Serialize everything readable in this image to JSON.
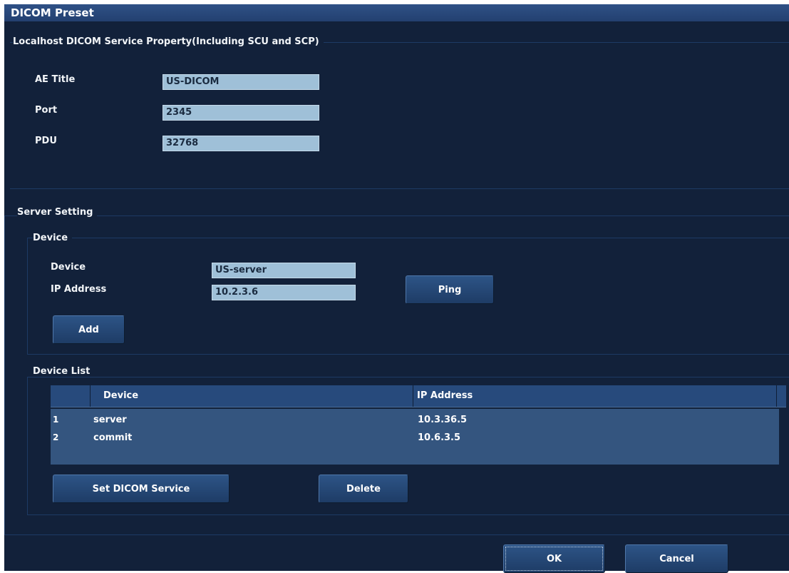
{
  "window": {
    "title": "DICOM Preset"
  },
  "localhost": {
    "group_label": "Localhost DICOM Service Property(Including SCU and SCP)",
    "ae_title_label": "AE Title",
    "ae_title_value": "US-DICOM",
    "port_label": "Port",
    "port_value": "2345",
    "pdu_label": "PDU",
    "pdu_value": "32768"
  },
  "server_setting": {
    "group_label": "Server Setting",
    "device_group": {
      "group_label": "Device",
      "device_label": "Device",
      "device_value": "US-server",
      "ip_label": "IP Address",
      "ip_value": "10.2.3.6",
      "ping_label": "Ping",
      "add_label": "Add"
    },
    "device_list": {
      "group_label": "Device List",
      "columns": [
        "Device",
        "IP Address"
      ],
      "rows": [
        {
          "index": "1",
          "device": "server",
          "ip": "10.3.36.5"
        },
        {
          "index": "2",
          "device": "commit",
          "ip": "10.6.3.5"
        }
      ],
      "set_service_label": "Set DICOM Service",
      "delete_label": "Delete"
    }
  },
  "footer": {
    "ok_label": "OK",
    "cancel_label": "Cancel"
  },
  "colors": {
    "background": "#12213a",
    "titlebar": "#2f5186",
    "field": "#9fc0d8",
    "button": "#2d5486",
    "table_body": "#34557f"
  }
}
